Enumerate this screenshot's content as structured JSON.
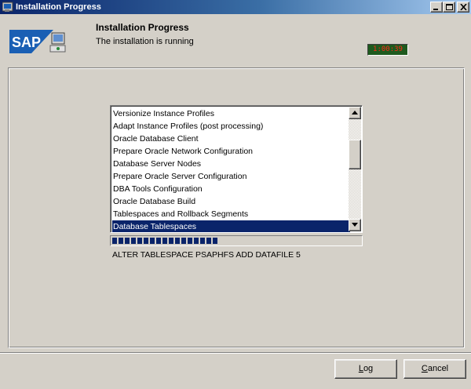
{
  "window": {
    "title": "Installation Progress",
    "icons": {
      "app": "sap-app-icon",
      "minimize": "minimize-icon",
      "maximize": "maximize-icon",
      "close": "close-icon"
    }
  },
  "header": {
    "logo_text": "SAP",
    "title": "Installation Progress",
    "subtitle": "The installation is running",
    "timer": "1:00:39"
  },
  "steps": [
    "Versionize Instance Profiles",
    "Adapt Instance Profiles (post processing)",
    "Oracle Database Client",
    "Prepare Oracle Network Configuration",
    "Database Server Nodes",
    "Prepare Oracle Server Configuration",
    "DBA Tools Configuration",
    "Oracle Database Build",
    "Tablespaces and Rollback Segments",
    "Database Tablespaces"
  ],
  "selected_step_index": 9,
  "progress": {
    "fraction": 0.43
  },
  "status_text": "ALTER TABLESPACE PSAPHFS ADD DATAFILE 5",
  "buttons": {
    "log": {
      "label": "Log",
      "mnemonic": "L",
      "rest": "og"
    },
    "cancel": {
      "label": "Cancel",
      "mnemonic": "C",
      "rest": "ancel"
    }
  },
  "colors": {
    "selection": "#0a246a",
    "progress": "#0a246a",
    "timer_text": "#ff2a1a",
    "timer_bg": "#1e5a1e",
    "logo_blue": "#1a5fb4"
  }
}
